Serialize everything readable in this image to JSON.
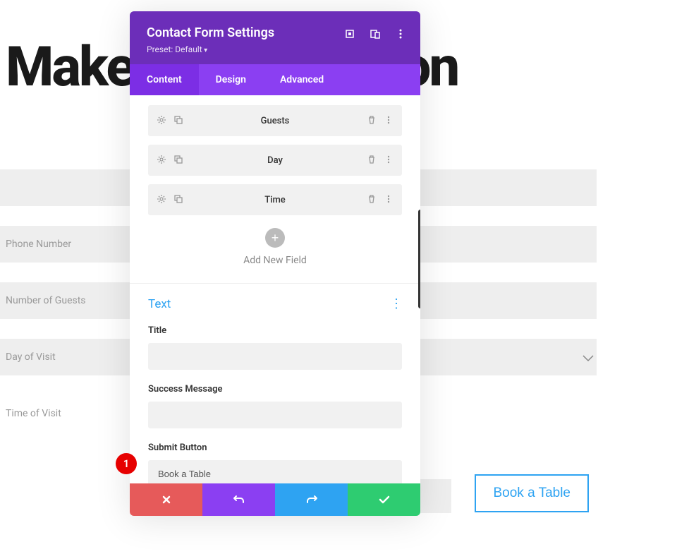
{
  "background": {
    "heading": "Make a Reservation",
    "fields": {
      "phone": "Phone Number",
      "guests": "Number of Guests",
      "visit": "Day of Visit",
      "time": "Time of Visit"
    },
    "submit_label": "Book a Table"
  },
  "modal": {
    "title": "Contact Form Settings",
    "preset": "Preset: Default",
    "tabs": {
      "content": "Content",
      "design": "Design",
      "advanced": "Advanced"
    },
    "fields": [
      {
        "label": "Guests"
      },
      {
        "label": "Day"
      },
      {
        "label": "Time"
      }
    ],
    "add_new_label": "Add New Field",
    "text_section": {
      "title": "Text",
      "title_label": "Title",
      "title_value": "",
      "success_label": "Success Message",
      "success_value": "",
      "submit_label": "Submit Button",
      "submit_value": "Book a Table"
    }
  },
  "marker": "1"
}
